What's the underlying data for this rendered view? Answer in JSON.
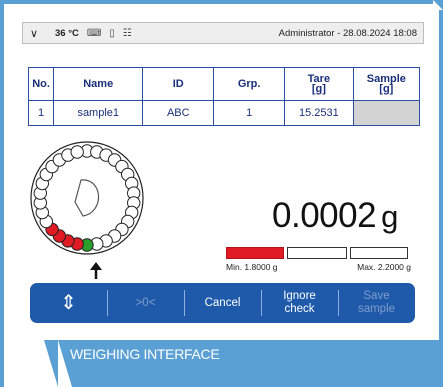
{
  "status_bar": {
    "menu_icon": "chevron-down-icon",
    "temperature": "36 °C",
    "icons": [
      "calendar-keyboard-icon",
      "thermometer-icon",
      "network-icon"
    ],
    "user_datetime": "Administrator - 28.08.2024 18:08"
  },
  "table": {
    "headers": [
      "No.",
      "Name",
      "ID",
      "Grp.",
      "Tare\n[g]",
      "Sample\n[g]"
    ],
    "rows": [
      [
        "1",
        "sample1",
        "ABC",
        "1",
        "15.2531",
        ""
      ]
    ]
  },
  "carousel": {
    "total_positions": 30,
    "red_positions": 4,
    "green_positions": 1,
    "pointer_icon": "arrow-up-icon"
  },
  "readout": {
    "value": "0.0002",
    "unit": "g",
    "min_label": "Min. 1.8000 g",
    "max_label": "Max. 2.2000 g",
    "fill_fraction": 0.33
  },
  "buttons": {
    "updown_icon": "up-down-arrow-icon",
    "zero": ">0<",
    "cancel": "Cancel",
    "ignore_check": "Ignore check",
    "save_sample": "Save sample"
  },
  "caption": "WEIGHING INTERFACE",
  "colors": {
    "accent": "#1f5aaa",
    "frame": "#5aa0d4",
    "red": "#e01b24",
    "green": "#2aa02a"
  }
}
